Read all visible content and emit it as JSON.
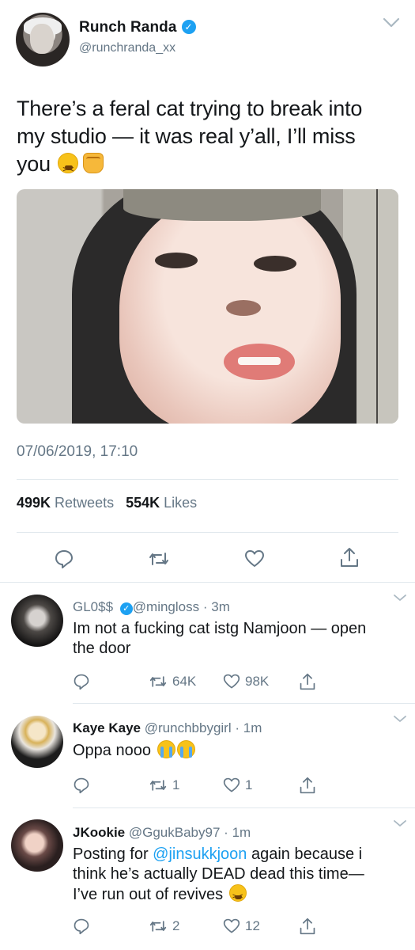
{
  "tweet": {
    "author_name": "Runch Randa",
    "handle": "@runchranda_xx",
    "text_line1": "There’s a feral cat trying to break into",
    "text_line2": "my studio — it was real y’all, I’ll miss",
    "text_line3": "you",
    "text_emojis": [
      "tired-face-emoji",
      "raised-fist-emoji"
    ],
    "timestamp": "07/06/2019, 17:10",
    "retweets_count": "499K",
    "retweets_label": "Retweets",
    "likes_count": "554K",
    "likes_label": "Likes",
    "icons": [
      "reply-icon",
      "retweet-icon",
      "like-icon",
      "share-icon"
    ]
  },
  "replies": [
    {
      "name": "GL0$$",
      "handle": "@mingloss",
      "verified": true,
      "separator": "·",
      "time": "3m",
      "text_line1": "Im not a fucking cat istg Namjoon — open",
      "text_line2": "the door",
      "retweets": "64K",
      "likes": "98K"
    },
    {
      "name": "Kaye Kaye",
      "handle": "@runchbbygirl",
      "separator": "·",
      "time": "1m",
      "text_line1": "Oppa nooo",
      "text_emojis": [
        "crying-face-emoji",
        "crying-face-emoji"
      ],
      "retweets": "1",
      "likes": "1"
    },
    {
      "name": "JKookie",
      "handle": "@GgukBaby97",
      "separator": "·",
      "time": "1m",
      "text_prefix": "Posting for",
      "mention": "@jinsukkjoon",
      "text_suffix": "again because i",
      "text_line2": "think he’s actually DEAD dead this time—",
      "text_line3": "I’ve run out of revives",
      "text_emojis": [
        "tired-face-emoji"
      ],
      "retweets": "2",
      "likes": "12"
    }
  ],
  "colors": {
    "accent": "#1da1f2",
    "secondary_text": "#657786",
    "primary_text": "#14171a",
    "divider": "#e1e8ed"
  }
}
